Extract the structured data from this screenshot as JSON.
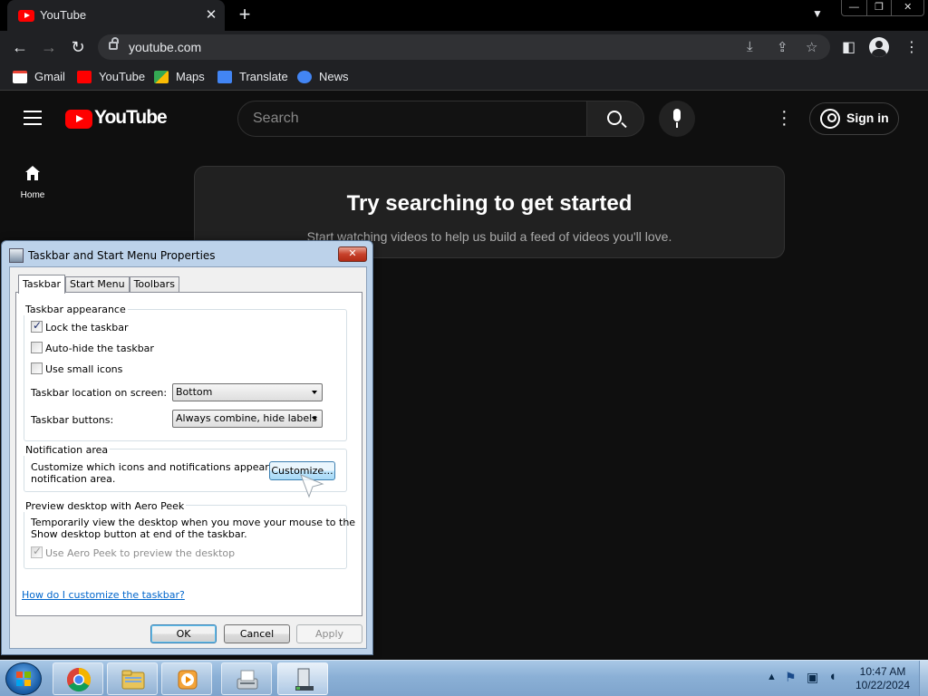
{
  "browser": {
    "tab_title": "YouTube",
    "url": "youtube.com",
    "bookmarks": [
      {
        "label": "Gmail",
        "icon": "gmail-icon",
        "color": "#ea4335"
      },
      {
        "label": "YouTube",
        "icon": "youtube-icon",
        "color": "#ff0000"
      },
      {
        "label": "Maps",
        "icon": "maps-icon",
        "color": "#34a853"
      },
      {
        "label": "Translate",
        "icon": "translate-icon",
        "color": "#4285f4"
      },
      {
        "label": "News",
        "icon": "news-icon",
        "color": "#4285f4"
      }
    ]
  },
  "youtube": {
    "logo_text": "YouTube",
    "search_placeholder": "Search",
    "sign_in_label": "Sign in",
    "sidebar_home": "Home",
    "empty_title": "Try searching to get started",
    "empty_subtitle": "Start watching videos to help us build a feed of videos you'll love."
  },
  "dialog": {
    "title": "Taskbar and Start Menu Properties",
    "tabs": [
      "Taskbar",
      "Start Menu",
      "Toolbars"
    ],
    "appearance": {
      "group_label": "Taskbar appearance",
      "lock_label": "Lock the taskbar",
      "lock_checked": true,
      "autohide_label": "Auto-hide the taskbar",
      "autohide_checked": false,
      "small_icons_label": "Use small icons",
      "small_icons_checked": false,
      "location_label": "Taskbar location on screen:",
      "location_value": "Bottom",
      "buttons_label": "Taskbar buttons:",
      "buttons_value": "Always combine, hide labels"
    },
    "notification": {
      "group_label": "Notification area",
      "text_line1": "Customize which icons and notifications appear in the",
      "text_line2": "notification area.",
      "customize_label": "Customize..."
    },
    "aero_peek": {
      "group_label": "Preview desktop with Aero Peek",
      "text_line1": "Temporarily view the desktop when you move your mouse to the",
      "text_line2": "Show desktop button at end of the taskbar.",
      "checkbox_label": "Use Aero Peek to preview the desktop",
      "checked": true
    },
    "help_link": "How do I customize the taskbar?",
    "ok_label": "OK",
    "cancel_label": "Cancel",
    "apply_label": "Apply"
  },
  "taskbar": {
    "time": "10:47 AM",
    "date": "10/22/2024",
    "items": [
      "chrome-icon",
      "explorer-icon",
      "media-player-icon",
      "fax-icon",
      "taskbar-properties-icon"
    ]
  }
}
